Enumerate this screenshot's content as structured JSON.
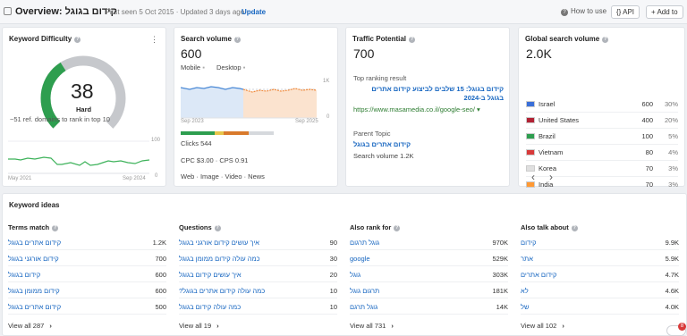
{
  "header": {
    "title": "Overview: קידום בגוגל",
    "meta": "First seen 5 Oct 2015 · Updated 3 days ago ·",
    "update_label": "Update",
    "how_to_use": "How to use",
    "api_label": "{} API",
    "add_to_label": "+ Add to"
  },
  "kd": {
    "title": "Keyword Difficulty",
    "value": "38",
    "level": "Hard",
    "level_fraction": 0.38,
    "note": "~51 ref. domains to rank in top 10",
    "axis_left": "May 2021",
    "axis_right": "Sep 2024",
    "y_top": "100",
    "y_bottom": "0"
  },
  "sv": {
    "title": "Search volume",
    "value": "600",
    "device_mobile": "Mobile",
    "device_desktop": "Desktop",
    "axis_left": "Sep 2023",
    "axis_right": "Sep 2025",
    "y_top": "1K",
    "y_bottom": "0",
    "clicks": "Clicks 544",
    "cpc": "CPC $3.00 · CPS 0.91",
    "serp": "Web · Image · Video · News"
  },
  "tp": {
    "title": "Traffic Potential",
    "value": "700",
    "top_label": "Top ranking result",
    "top_title": "קידום בגוגל: 15 שלבים לביצוע קידום אתרים בגוגל ב-2024",
    "top_url": "https://www.masamedia.co.il/google-seo/",
    "parent_label": "Parent Topic",
    "parent_value": "קידום אתרים בגוגל",
    "parent_volume": "Search volume 1.2K"
  },
  "gsv": {
    "title": "Global search volume",
    "value": "2.0K",
    "countries": [
      {
        "name": "Israel",
        "volume": "600",
        "share": "30%"
      },
      {
        "name": "United States",
        "volume": "400",
        "share": "20%"
      },
      {
        "name": "Brazil",
        "volume": "100",
        "share": "5%"
      },
      {
        "name": "Vietnam",
        "volume": "80",
        "share": "4%"
      },
      {
        "name": "Korea",
        "volume": "70",
        "share": "3%"
      },
      {
        "name": "India",
        "volume": "70",
        "share": "3%"
      }
    ],
    "prev": "‹",
    "next": "›"
  },
  "ideas": {
    "title": "Keyword ideas",
    "columns": [
      {
        "header": "Terms match",
        "rows": [
          {
            "k": "קידום אתרים בגוגל",
            "v": "1.2K"
          },
          {
            "k": "קידום אורגני בגוגל",
            "v": "700"
          },
          {
            "k": "קידום בגוגל",
            "v": "600"
          },
          {
            "k": "קידום ממומן בגוגל",
            "v": "600"
          },
          {
            "k": "קידום אתרים בגוגל",
            "v": "500"
          }
        ],
        "view_all": "View all 287"
      },
      {
        "header": "Questions",
        "rows": [
          {
            "k": "איך עושים קידום אורגני בגוגל",
            "v": "90"
          },
          {
            "k": "כמה עולה קידום ממומן בגוגל",
            "v": "30"
          },
          {
            "k": "איך עושים קידום בגוגל",
            "v": "20"
          },
          {
            "k": "כמה עולה קידום אתרים בגוגל?",
            "v": "10"
          },
          {
            "k": "כמה עולה קידום בגוגל",
            "v": "10"
          }
        ],
        "view_all": "View all 19"
      },
      {
        "header": "Also rank for",
        "rows": [
          {
            "k": "גוגל תרגום",
            "v": "970K"
          },
          {
            "k": "google",
            "v": "529K"
          },
          {
            "k": "גוגל",
            "v": "303K"
          },
          {
            "k": "תרגום גוגל",
            "v": "181K"
          },
          {
            "k": "גוגל תרגם",
            "v": "14K"
          }
        ],
        "view_all": "View all 731"
      },
      {
        "header": "Also talk about",
        "rows": [
          {
            "k": "קידום",
            "v": "9.9K"
          },
          {
            "k": "אתר",
            "v": "5.9K"
          },
          {
            "k": "קידום אתרים",
            "v": "4.7K"
          },
          {
            "k": "לא",
            "v": "4.6K"
          },
          {
            "k": "של",
            "v": "4.0K"
          }
        ],
        "view_all": "View all 102"
      }
    ]
  },
  "colors": {
    "accent": "#1565c0",
    "kd_track": "#c6c8cc",
    "kd_green": "#2e9e4f",
    "chart_blue": "#dce8f7",
    "chart_orange": "#fbe3cf",
    "green_line": "#3db25a"
  },
  "badge": "8"
}
